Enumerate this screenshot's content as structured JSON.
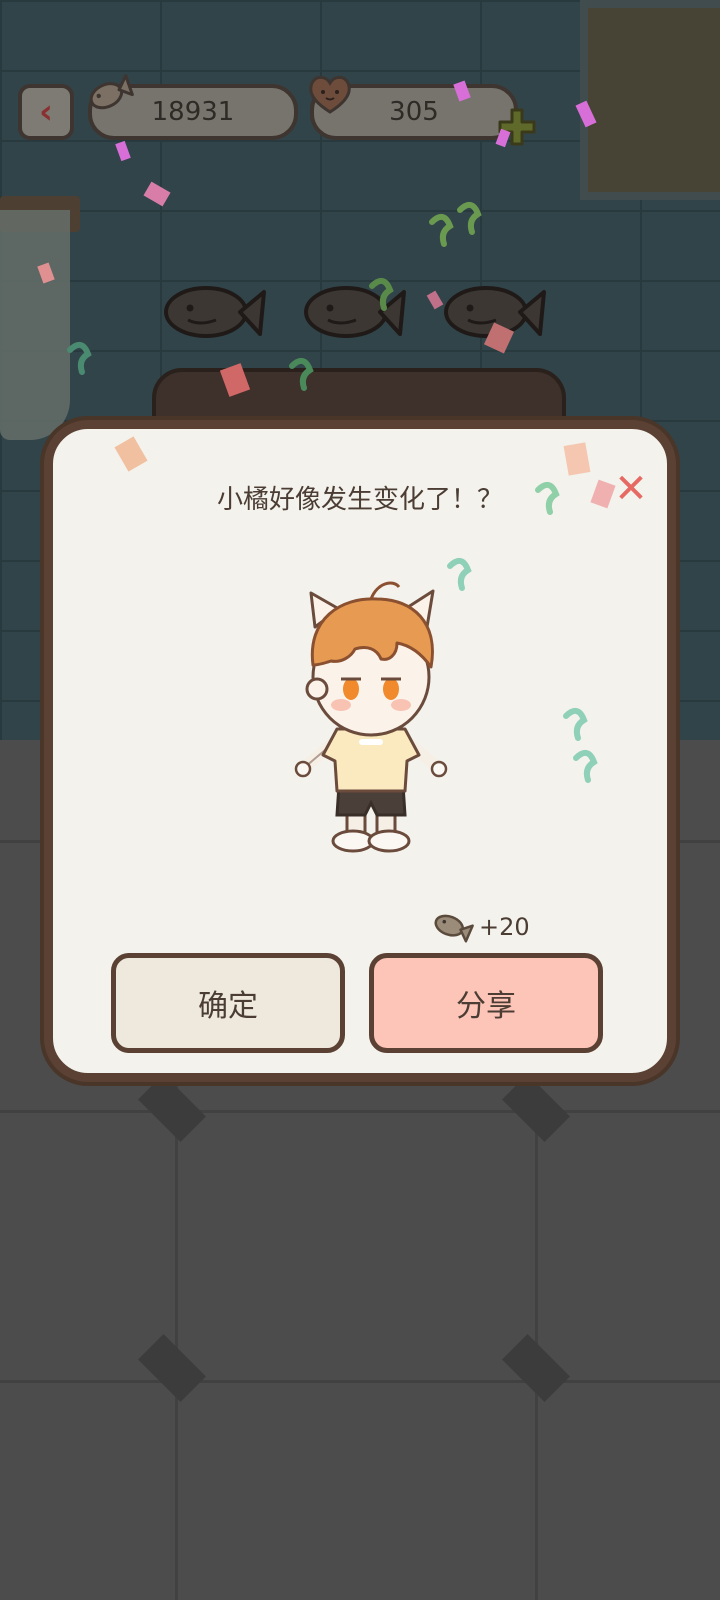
{
  "hud": {
    "back_icon": "back-arrow-icon",
    "fish_count": "18931",
    "heart_count": "305"
  },
  "dialog": {
    "title": "小橘好像发生变化了！？",
    "reward_text": "+20",
    "confirm_label": "确定",
    "share_label": "分享"
  },
  "colors": {
    "dialog_bg": "#f4f2ec",
    "dialog_border": "#5b4133",
    "confirm_bg": "#efe9dd",
    "share_bg": "#fdc4b8",
    "close_color": "#e66a63"
  }
}
